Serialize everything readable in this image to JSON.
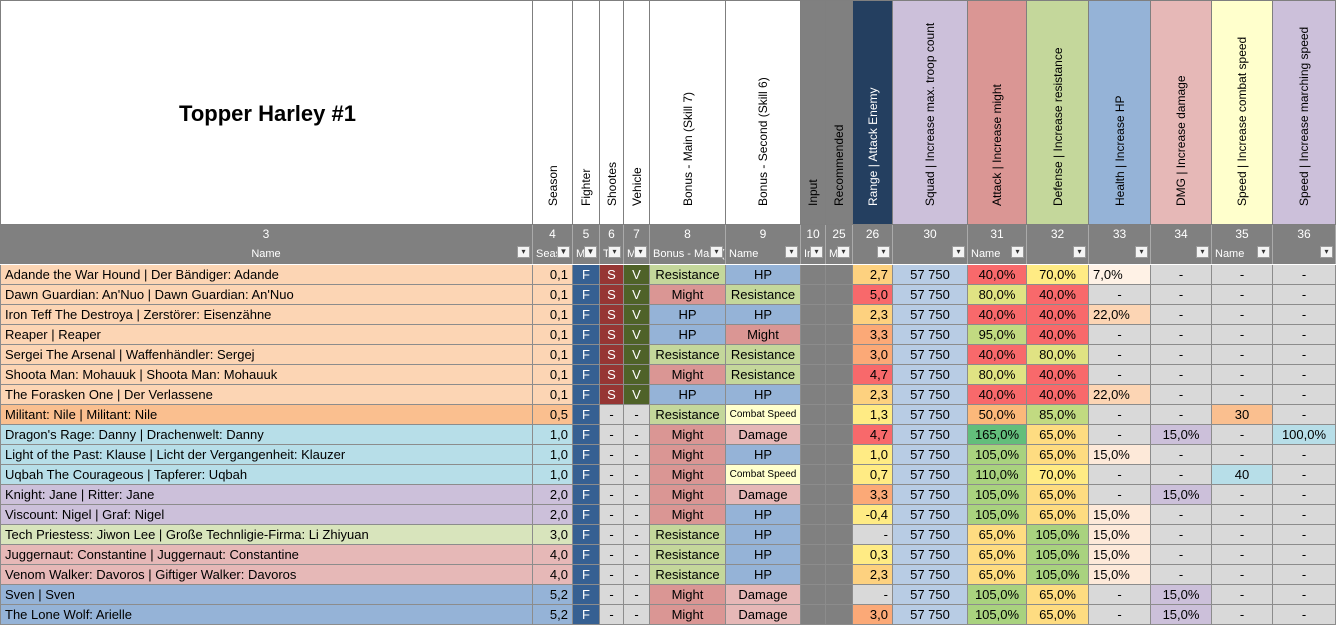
{
  "sheet": {
    "title": "Topper Harley #1",
    "headers": [
      "Season",
      "Fighter",
      "Shootes",
      "Vehicle",
      "Bonus - Main (Skill 7)",
      "Bonus - Second (Skill 6)",
      "Input",
      "Recommended",
      "Range | Attack Enemy",
      "Squad | Increase max. troop count",
      "Attack | Increase might",
      "Defense | Increase resistance",
      "Health | Increase HP",
      "DMG | Increase damage",
      "Speed | Increase combat speed",
      "Speed | Increase marching speed"
    ],
    "col_numbers": [
      "3",
      "4",
      "5",
      "6",
      "7",
      "8",
      "9",
      "10",
      "25",
      "26",
      "30",
      "31",
      "32",
      "33",
      "34",
      "35",
      "36"
    ],
    "filter_labels": [
      "Name",
      "Seas",
      "M",
      "T",
      "M",
      "Bonus - Main (Ski",
      "Name",
      "In",
      "M",
      "",
      "",
      "Name",
      "",
      "",
      "",
      "Name",
      ""
    ],
    "filter_icons": [
      "dropdown-icon",
      "filter-icon",
      "filter-icon",
      "dropdown-icon",
      "dropdown-icon",
      "dropdown-icon",
      "dropdown-icon",
      "dropdown-icon",
      "dropdown-icon",
      "dropdown-icon",
      "dropdown-icon",
      "dropdown-icon",
      "dropdown-icon",
      "dropdown-icon",
      "dropdown-icon",
      "dropdown-icon",
      "dropdown-icon"
    ],
    "colors": {
      "range_header": "#243f60",
      "lavender": "#ccc0da",
      "red_header": "#da9694",
      "green_header": "#c4d79b",
      "blue_header": "#95b3d7",
      "pink_header": "#e6b8b7",
      "yellow_header": "#ffffcc",
      "dark_gray": "#808080",
      "fighter_blue": "#366092",
      "shoots_red": "#963634",
      "vehicle_green": "#4f6228"
    },
    "rows": [
      [
        "Adande the War Hound | Der Bändiger: Adande",
        "0,1",
        "F",
        "S",
        "V",
        "Resistance",
        "HP",
        "",
        "",
        "2,7",
        "57 750",
        "40,0%",
        "70,0%",
        "7,0%",
        "-",
        "-",
        "-"
      ],
      [
        "Dawn Guardian: An'Nuo | Dawn Guardian: An'Nuo",
        "0,1",
        "F",
        "S",
        "V",
        "Might",
        "Resistance",
        "",
        "",
        "5,0",
        "57 750",
        "80,0%",
        "40,0%",
        "-",
        "-",
        "-",
        "-"
      ],
      [
        "Iron Teff The Destroya | Zerstörer: Eisenzähne",
        "0,1",
        "F",
        "S",
        "V",
        "HP",
        "HP",
        "",
        "",
        "2,3",
        "57 750",
        "40,0%",
        "40,0%",
        "22,0%",
        "-",
        "-",
        "-"
      ],
      [
        "Reaper | Reaper",
        "0,1",
        "F",
        "S",
        "V",
        "HP",
        "Might",
        "",
        "",
        "3,3",
        "57 750",
        "95,0%",
        "40,0%",
        "-",
        "-",
        "-",
        "-"
      ],
      [
        "Sergei The Arsenal | Waffenhändler: Sergej",
        "0,1",
        "F",
        "S",
        "V",
        "Resistance",
        "Resistance",
        "",
        "",
        "3,0",
        "57 750",
        "40,0%",
        "80,0%",
        "-",
        "-",
        "-",
        "-"
      ],
      [
        "Shoota Man: Mohauuk | Shoota Man: Mohauuk",
        "0,1",
        "F",
        "S",
        "V",
        "Might",
        "Resistance",
        "",
        "",
        "4,7",
        "57 750",
        "80,0%",
        "40,0%",
        "-",
        "-",
        "-",
        "-"
      ],
      [
        "The Forasken One | Der Verlassene",
        "0,1",
        "F",
        "S",
        "V",
        "HP",
        "HP",
        "",
        "",
        "2,3",
        "57 750",
        "40,0%",
        "40,0%",
        "22,0%",
        "-",
        "-",
        "-"
      ],
      [
        "Militant: Nile | Militant: Nile",
        "0,5",
        "F",
        "-",
        "-",
        "Resistance",
        "Combat Speed",
        "",
        "",
        "1,3",
        "57 750",
        "50,0%",
        "85,0%",
        "-",
        "-",
        "30",
        "-"
      ],
      [
        "Dragon's Rage: Danny | Drachenwelt: Danny",
        "1,0",
        "F",
        "-",
        "-",
        "Might",
        "Damage",
        "",
        "",
        "4,7",
        "57 750",
        "165,0%",
        "65,0%",
        "-",
        "15,0%",
        "-",
        "100,0%"
      ],
      [
        "Light of the Past: Klause | Licht der Vergangenheit: Klauzer",
        "1,0",
        "F",
        "-",
        "-",
        "Might",
        "HP",
        "",
        "",
        "1,0",
        "57 750",
        "105,0%",
        "65,0%",
        "15,0%",
        "-",
        "-",
        "-"
      ],
      [
        "Uqbah The Courageous | Tapferer: Uqbah",
        "1,0",
        "F",
        "-",
        "-",
        "Might",
        "Combat Speed",
        "",
        "",
        "0,7",
        "57 750",
        "110,0%",
        "70,0%",
        "-",
        "-",
        "40",
        "-"
      ],
      [
        "Knight: Jane | Ritter: Jane",
        "2,0",
        "F",
        "-",
        "-",
        "Might",
        "Damage",
        "",
        "",
        "3,3",
        "57 750",
        "105,0%",
        "65,0%",
        "-",
        "15,0%",
        "-",
        "-"
      ],
      [
        "Viscount: Nigel | Graf: Nigel",
        "2,0",
        "F",
        "-",
        "-",
        "Might",
        "HP",
        "",
        "",
        "-0,4",
        "57 750",
        "105,0%",
        "65,0%",
        "15,0%",
        "-",
        "-",
        "-"
      ],
      [
        "Tech Priestess: Jiwon Lee | Große Technligie-Firma: Li Zhiyuan",
        "3,0",
        "F",
        "-",
        "-",
        "Resistance",
        "HP",
        "",
        "",
        "-",
        "57 750",
        "65,0%",
        "105,0%",
        "15,0%",
        "-",
        "-",
        "-"
      ],
      [
        "Juggernaut: Constantine | Juggernaut: Constantine",
        "4,0",
        "F",
        "-",
        "-",
        "Resistance",
        "HP",
        "",
        "",
        "0,3",
        "57 750",
        "65,0%",
        "105,0%",
        "15,0%",
        "-",
        "-",
        "-"
      ],
      [
        "Venom Walker: Davoros | Giftiger Walker: Davoros",
        "4,0",
        "F",
        "-",
        "-",
        "Resistance",
        "HP",
        "",
        "",
        "2,3",
        "57 750",
        "65,0%",
        "105,0%",
        "15,0%",
        "-",
        "-",
        "-"
      ],
      [
        "Sven | Sven",
        "5,2",
        "F",
        "-",
        "-",
        "Might",
        "Damage",
        "",
        "",
        "-",
        "57 750",
        "105,0%",
        "65,0%",
        "-",
        "15,0%",
        "-",
        "-"
      ],
      [
        "The Lone Wolf: Arielle",
        "5,2",
        "F",
        "-",
        "-",
        "Might",
        "Damage",
        "",
        "",
        "3,0",
        "57 750",
        "105,0%",
        "65,0%",
        "-",
        "15,0%",
        "-",
        "-"
      ]
    ]
  }
}
